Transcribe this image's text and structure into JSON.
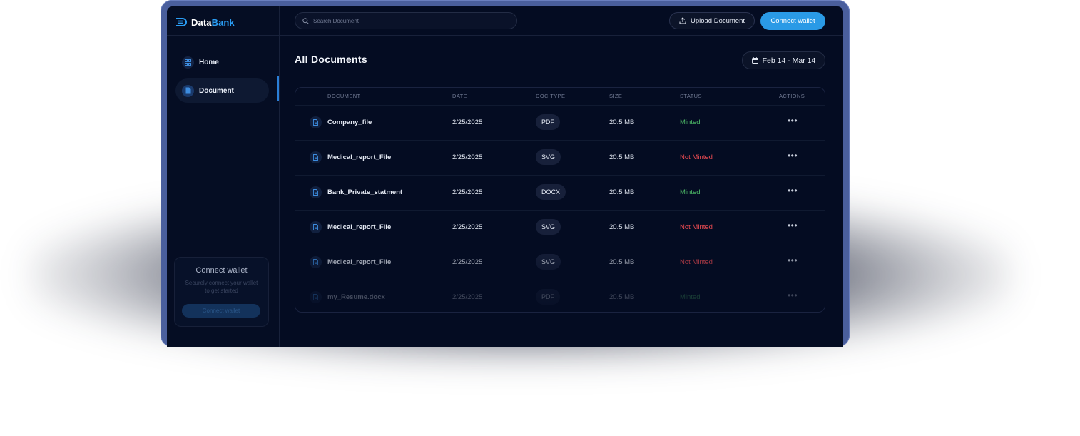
{
  "app": {
    "logo_part1": "Data",
    "logo_part2": "Bank",
    "brand_color": "#2a9df4"
  },
  "sidebar": {
    "items": [
      {
        "label": "Home",
        "icon": "grid-icon",
        "active": false
      },
      {
        "label": "Document",
        "icon": "file-icon",
        "active": true
      }
    ],
    "wallet_card": {
      "title": "Connect wallet",
      "description": "Securely connect your wallet to get started",
      "button_label": "Connect wallet"
    }
  },
  "topbar": {
    "search_placeholder": "Search Document",
    "upload_label": "Upload Document",
    "connect_label": "Connect wallet"
  },
  "main": {
    "title": "All Documents",
    "date_range": "Feb 14 - Mar 14"
  },
  "table": {
    "headers": [
      "DOCUMENT",
      "DATE",
      "DOC TYPE",
      "SIZE",
      "STATUS",
      "ACTIONS"
    ],
    "rows": [
      {
        "name": "Company_file",
        "date": "2/25/2025",
        "type": "PDF",
        "size": "20.5 MB",
        "status": "Minted"
      },
      {
        "name": "Medical_report_File",
        "date": "2/25/2025",
        "type": "SVG",
        "size": "20.5 MB",
        "status": "Not Minted"
      },
      {
        "name": "Bank_Private_statment",
        "date": "2/25/2025",
        "type": "DOCX",
        "size": "20.5 MB",
        "status": "Minted"
      },
      {
        "name": "Medical_report_File",
        "date": "2/25/2025",
        "type": "SVG",
        "size": "20.5 MB",
        "status": "Not Minted"
      },
      {
        "name": "Medical_report_File",
        "date": "2/25/2025",
        "type": "SVG",
        "size": "20.5 MB",
        "status": "Not Minted"
      },
      {
        "name": "my_Resume.docx",
        "date": "2/25/2025",
        "type": "PDF",
        "size": "20.5 MB",
        "status": "Minted"
      }
    ],
    "actions_glyph": "•••",
    "status_colors": {
      "Minted": "#4fbd68",
      "Not Minted": "#ec4b52"
    }
  }
}
